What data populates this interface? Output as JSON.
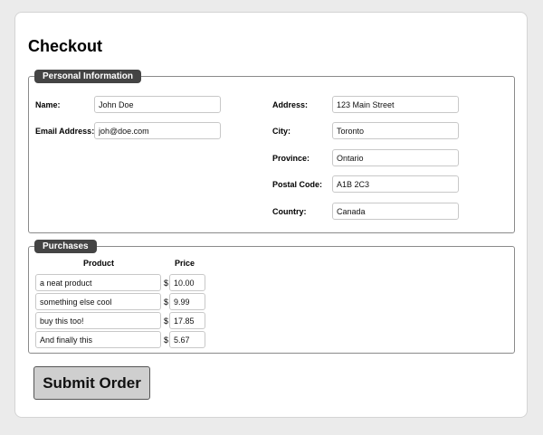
{
  "page": {
    "title": "Checkout"
  },
  "personal": {
    "legend": "Personal Information",
    "fields": {
      "name": {
        "label": "Name:",
        "value": "John Doe"
      },
      "email": {
        "label": "Email Address:",
        "value": "joh@doe.com"
      },
      "address": {
        "label": "Address:",
        "value": "123 Main Street"
      },
      "city": {
        "label": "City:",
        "value": "Toronto"
      },
      "province": {
        "label": "Province:",
        "value": "Ontario"
      },
      "postal": {
        "label": "Postal Code:",
        "value": "A1B 2C3"
      },
      "country": {
        "label": "Country:",
        "value": "Canada"
      }
    }
  },
  "purchases": {
    "legend": "Purchases",
    "headers": {
      "product": "Product",
      "price": "Price"
    },
    "currency_symbol": "$",
    "items": [
      {
        "product": "a neat product",
        "price": "10.00"
      },
      {
        "product": "something else cool",
        "price": "9.99"
      },
      {
        "product": "buy this too!",
        "price": "17.85"
      },
      {
        "product": "And finally this",
        "price": "5.67"
      }
    ]
  },
  "submit": {
    "label": "Submit Order"
  }
}
